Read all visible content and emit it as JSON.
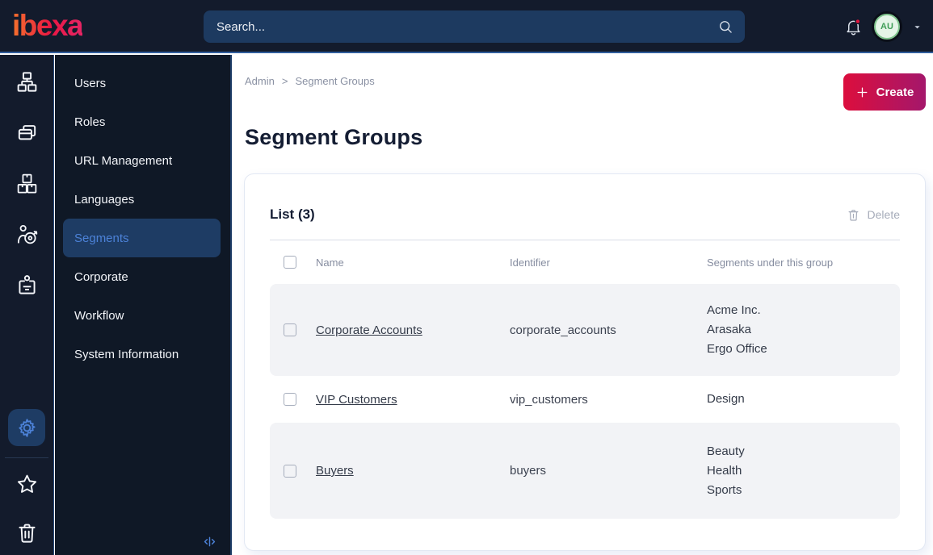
{
  "topbar": {
    "logo_text": "ibexa",
    "search_placeholder": "Search...",
    "avatar_initials": "AU"
  },
  "rail": {
    "icons": [
      "content-tree",
      "content-list",
      "product-catalog",
      "personalization",
      "corporate"
    ],
    "bottom_icons": [
      "settings-gear",
      "favorites-star",
      "trash"
    ]
  },
  "sidebar": {
    "items": [
      {
        "label": "Users",
        "active": false
      },
      {
        "label": "Roles",
        "active": false
      },
      {
        "label": "URL Management",
        "active": false
      },
      {
        "label": "Languages",
        "active": false
      },
      {
        "label": "Segments",
        "active": true
      },
      {
        "label": "Corporate",
        "active": false
      },
      {
        "label": "Workflow",
        "active": false
      },
      {
        "label": "System Information",
        "active": false
      }
    ]
  },
  "breadcrumb": {
    "items": [
      "Admin",
      "Segment Groups"
    ],
    "separator": ">"
  },
  "page": {
    "title": "Segment Groups",
    "create_label": "Create"
  },
  "list": {
    "title": "List (3)",
    "delete_label": "Delete",
    "columns": [
      "Name",
      "Identifier",
      "Segments under this group"
    ],
    "rows": [
      {
        "name": "Corporate Accounts",
        "identifier": "corporate_accounts",
        "segments": [
          "Acme Inc.",
          "Arasaka",
          "Ergo Office"
        ]
      },
      {
        "name": "VIP Customers",
        "identifier": "vip_customers",
        "segments": [
          "Design"
        ]
      },
      {
        "name": "Buyers",
        "identifier": "buyers",
        "segments": [
          "Beauty",
          "Health",
          "Sports"
        ]
      }
    ]
  },
  "colors": {
    "topbar_bg": "#131b2c",
    "sidebar_bg": "#0f1826",
    "accent_blue": "#4c82d8",
    "active_item_bg": "#1e3c64",
    "search_bg": "#1d3a60",
    "create_gradient_start": "#dc0e3d",
    "create_gradient_end": "#a4176b",
    "notification_red": "#e0133c",
    "avatar_bg": "#e4f5e7",
    "avatar_text": "#3f9e57",
    "row_shaded_bg": "#f2f3f6",
    "logo_gradient_start": "#f4692e",
    "logo_gradient_end": "#e52462"
  }
}
